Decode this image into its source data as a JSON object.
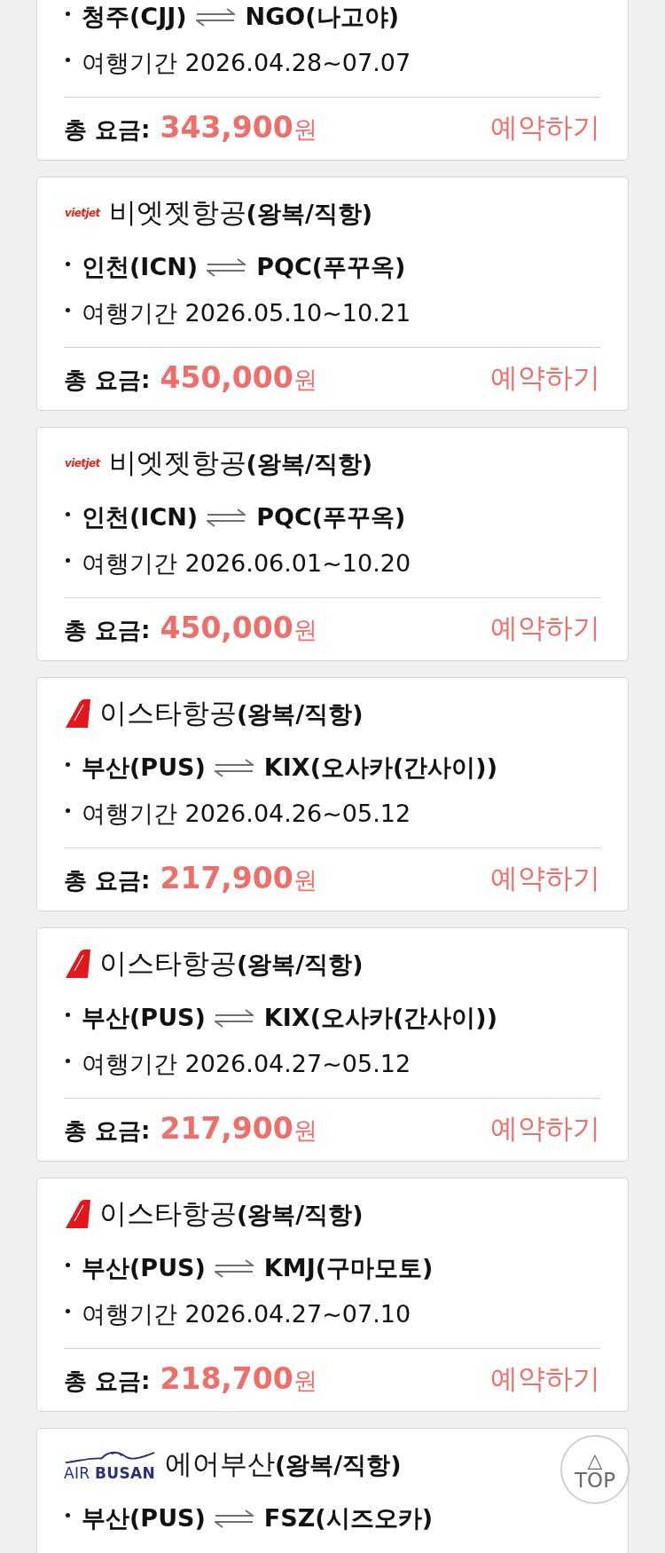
{
  "fares": [
    {
      "route": {
        "from": "청주(CJJ)",
        "to": "NGO(나고야)"
      },
      "period": "여행기간 2026.04.28~07.07",
      "price": {
        "label": "총 요금:",
        "amount": "**343,900**원"
      },
      "book_link": "예약하기"
    },
    {
      "airline": {
        "logo": {
          "kind": "wordmark",
          "text": "vietjet"
        },
        "title": "비엣젯항공**(왕복/직항)**"
      },
      "route": {
        "from": "인천(ICN)",
        "to": "PQC(푸꾸옥)"
      },
      "period": "여행기간 2026.05.10~10.21",
      "price": {
        "label": "총 요금:",
        "amount": "**450,000**원"
      },
      "book_link": "예약하기"
    },
    {
      "airline": {
        "logo": {
          "kind": "wordmark",
          "text": "vietjet"
        },
        "title": "비엣젯항공**(왕복/직항)**"
      },
      "route": {
        "from": "인천(ICN)",
        "to": "PQC(푸꾸옥)"
      },
      "period": "여행기간 2026.06.01~10.20",
      "price": {
        "label": "총 요금:",
        "amount": "**450,000**원"
      },
      "book_link": "예약하기"
    },
    {
      "airline": {
        "logo": {
          "kind": "tail-fin"
        },
        "title": "이스타항공**(왕복/직항)**"
      },
      "route": {
        "from": "부산(PUS)",
        "to": "KIX(오사카(간사이))"
      },
      "period": "여행기간 2026.04.26~05.12",
      "price": {
        "label": "총 요금:",
        "amount": "**217,900**원"
      },
      "book_link": "예약하기"
    },
    {
      "airline": {
        "logo": {
          "kind": "tail-fin"
        },
        "title": "이스타항공**(왕복/직항)**"
      },
      "route": {
        "from": "부산(PUS)",
        "to": "KIX(오사카(간사이))"
      },
      "period": "여행기간 2026.04.27~05.12",
      "price": {
        "label": "총 요금:",
        "amount": "**217,900**원"
      },
      "book_link": "예약하기"
    },
    {
      "airline": {
        "logo": {
          "kind": "tail-fin"
        },
        "title": "이스타항공**(왕복/직항)**"
      },
      "route": {
        "from": "부산(PUS)",
        "to": "KMJ(구마모토)"
      },
      "period": "여행기간 2026.04.27~07.10",
      "price": {
        "label": "총 요금:",
        "amount": "**218,700**원"
      },
      "book_link": "예약하기"
    },
    {
      "airline": {
        "logo": {
          "kind": "wordmark-bird",
          "text": "AIR **BUSAN**"
        },
        "title": "에어부산**(왕복/직항)**"
      },
      "route": {
        "from": "부산(PUS)",
        "to": "FSZ(시즈오카)"
      }
    }
  ],
  "top_button": {
    "icon": "△",
    "label": "TOP"
  }
}
